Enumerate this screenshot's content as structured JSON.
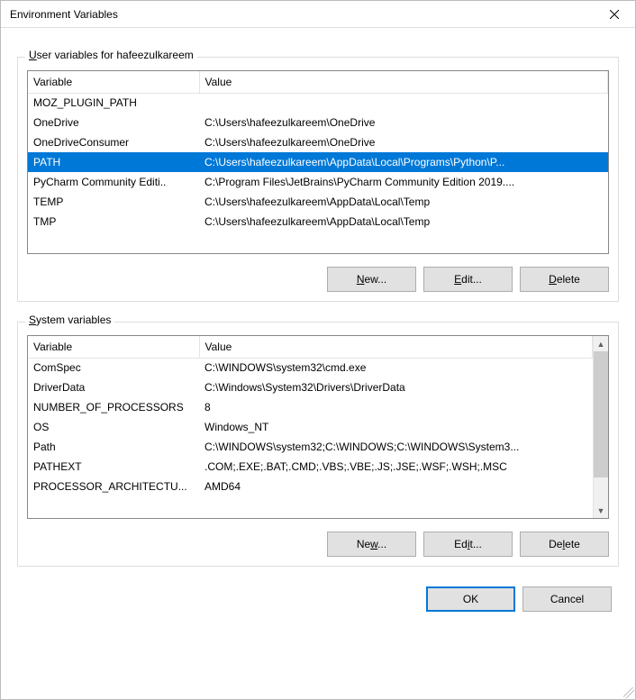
{
  "window": {
    "title": "Environment Variables"
  },
  "user_group": {
    "label_prefix": "U",
    "label_rest": "ser variables for hafeezulkareem"
  },
  "columns": {
    "variable": "Variable",
    "value": "Value"
  },
  "user_vars": [
    {
      "name": "MOZ_PLUGIN_PATH",
      "value": "",
      "selected": false
    },
    {
      "name": "OneDrive",
      "value": "C:\\Users\\hafeezulkareem\\OneDrive",
      "selected": false
    },
    {
      "name": "OneDriveConsumer",
      "value": "C:\\Users\\hafeezulkareem\\OneDrive",
      "selected": false
    },
    {
      "name": "PATH",
      "value": "C:\\Users\\hafeezulkareem\\AppData\\Local\\Programs\\Python\\P...",
      "selected": true
    },
    {
      "name": "PyCharm Community Editi..",
      "value": "C:\\Program Files\\JetBrains\\PyCharm Community Edition 2019....",
      "selected": false
    },
    {
      "name": "TEMP",
      "value": "C:\\Users\\hafeezulkareem\\AppData\\Local\\Temp",
      "selected": false
    },
    {
      "name": "TMP",
      "value": "C:\\Users\\hafeezulkareem\\AppData\\Local\\Temp",
      "selected": false
    }
  ],
  "sys_group": {
    "label_prefix": "S",
    "label_rest": "ystem variables"
  },
  "sys_vars": [
    {
      "name": "ComSpec",
      "value": "C:\\WINDOWS\\system32\\cmd.exe"
    },
    {
      "name": "DriverData",
      "value": "C:\\Windows\\System32\\Drivers\\DriverData"
    },
    {
      "name": "NUMBER_OF_PROCESSORS",
      "value": "8"
    },
    {
      "name": "OS",
      "value": "Windows_NT"
    },
    {
      "name": "Path",
      "value": "C:\\WINDOWS\\system32;C:\\WINDOWS;C:\\WINDOWS\\System3..."
    },
    {
      "name": "PATHEXT",
      "value": ".COM;.EXE;.BAT;.CMD;.VBS;.VBE;.JS;.JSE;.WSF;.WSH;.MSC"
    },
    {
      "name": "PROCESSOR_ARCHITECTU...",
      "value": "AMD64"
    }
  ],
  "buttons": {
    "new_u": "N",
    "new_rest": "ew...",
    "edit_u": "E",
    "edit_rest": "dit...",
    "delete_u": "D",
    "delete_rest": "elete",
    "new2_pre": "Ne",
    "new2_u": "w",
    "new2_rest": "...",
    "edit2_pre": "Ed",
    "edit2_u": "i",
    "edit2_rest": "t...",
    "delete2_pre": "De",
    "delete2_u": "l",
    "delete2_rest": "ete",
    "ok": "OK",
    "cancel": "Cancel"
  }
}
